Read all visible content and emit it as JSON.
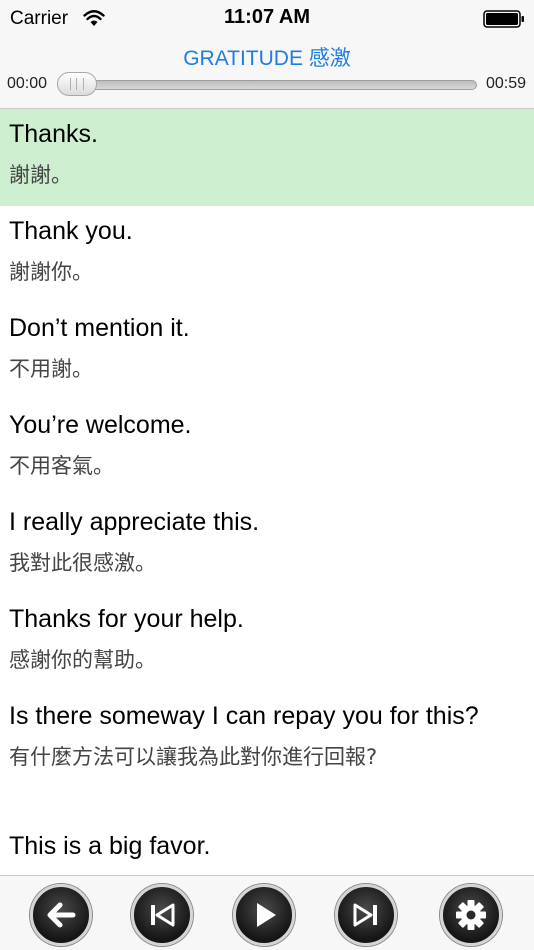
{
  "status_bar": {
    "carrier": "Carrier",
    "time": "11:07 AM"
  },
  "header": {
    "title": "GRATITUDE 感激",
    "time_start": "00:00",
    "time_end": "00:59",
    "progress": 0.0
  },
  "phrases": [
    {
      "en": "Thanks.",
      "zh": "謝謝。",
      "active": true
    },
    {
      "en": "Thank you.",
      "zh": "謝謝你。"
    },
    {
      "en": "Don’t mention it.",
      "zh": "不用謝。"
    },
    {
      "en": "You’re welcome.",
      "zh": "不用客氣。"
    },
    {
      "en": "I really appreciate this.",
      "zh": "我對此很感激。"
    },
    {
      "en": "Thanks for your help.",
      "zh": "感謝你的幫助。"
    },
    {
      "en": "Is there someway I can repay you for this?",
      "zh": "有什麼方法可以讓我為此對你進行回報?"
    },
    {
      "en": "This is a big favor.",
      "zh": ""
    }
  ],
  "toolbar": {
    "buttons": [
      "back-arrow-icon",
      "skip-previous-icon",
      "play-icon",
      "skip-next-icon",
      "gear-icon"
    ]
  },
  "colors": {
    "accent": "#1e7fe0",
    "active_row": "#cdefd0"
  }
}
